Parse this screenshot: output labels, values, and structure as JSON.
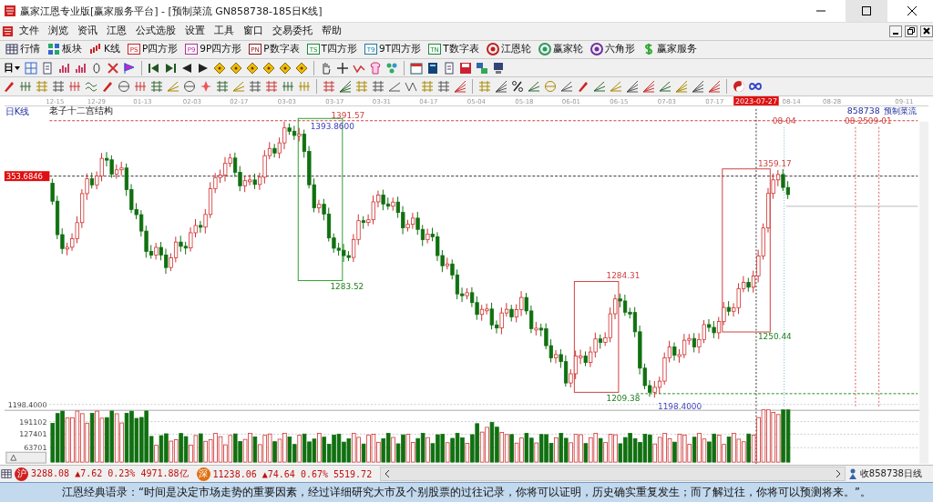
{
  "window": {
    "title": "赢家江恩专业版[赢家服务平台] - [预制菜流  GN858738-185日K线]"
  },
  "menu": [
    "文件",
    "浏览",
    "资讯",
    "江恩",
    "公式选股",
    "设置",
    "工具",
    "窗口",
    "交易委托",
    "帮助"
  ],
  "toolbar": [
    {
      "label": "行情",
      "kind": "table"
    },
    {
      "label": "板块",
      "kind": "blocks"
    },
    {
      "label": "K线",
      "kind": "kline"
    },
    {
      "label": "P四方形",
      "kind": "tag",
      "tag": "PS",
      "color": "#cc2222"
    },
    {
      "label": "9P四方形",
      "kind": "tag",
      "tag": "P9",
      "color": "#b0309a"
    },
    {
      "label": "P数字表",
      "kind": "tag",
      "tag": "PN",
      "color": "#8a1a1a"
    },
    {
      "label": "T四方形",
      "kind": "tag",
      "tag": "TS",
      "color": "#1a8a3a"
    },
    {
      "label": "9T四方形",
      "kind": "tag",
      "tag": "T9",
      "color": "#1a7aa0"
    },
    {
      "label": "T数字表",
      "kind": "tag",
      "tag": "TN",
      "color": "#1a8a3a"
    },
    {
      "label": "江恩轮",
      "kind": "wheel",
      "color": "#c02020"
    },
    {
      "label": "赢家轮",
      "kind": "wheel",
      "color": "#2a9a5a"
    },
    {
      "label": "六角形",
      "kind": "wheel",
      "color": "#7030a0"
    },
    {
      "label": "赢家服务",
      "kind": "dollar"
    }
  ],
  "period_selector": "日",
  "chart": {
    "period_label": "日K线",
    "study_title": "老子十二宫结构",
    "price_tag": "353.6846",
    "code": "858738",
    "name": "预制菜流",
    "dates": [
      {
        "label": "12-15",
        "selected": false
      },
      {
        "label": "12-29",
        "selected": false
      },
      {
        "label": "01-13",
        "selected": false
      },
      {
        "label": "02-03",
        "selected": false
      },
      {
        "label": "02-17",
        "selected": false
      },
      {
        "label": "03-03",
        "selected": false
      },
      {
        "label": "03-17",
        "selected": false
      },
      {
        "label": "03-31",
        "selected": false
      },
      {
        "label": "04-17",
        "selected": false
      },
      {
        "label": "05-04",
        "selected": false
      },
      {
        "label": "05-18",
        "selected": false
      },
      {
        "label": "06-01",
        "selected": false
      },
      {
        "label": "06-15",
        "selected": false
      },
      {
        "label": "07-03",
        "selected": false
      },
      {
        "label": "07-17",
        "selected": false
      },
      {
        "label": "2023-07-27",
        "selected": true
      },
      {
        "label": "08-14",
        "selected": false
      },
      {
        "label": "08-28",
        "selected": false
      },
      {
        "label": "09-11",
        "selected": false
      }
    ],
    "annotations": [
      {
        "text": "1391.57",
        "color": "#d04040"
      },
      {
        "text": "1393.8600",
        "color": "#4040c0"
      },
      {
        "text": "1283.52",
        "color": "#208020"
      },
      {
        "text": "1284.31",
        "color": "#d04040"
      },
      {
        "text": "1209.38",
        "color": "#208020"
      },
      {
        "text": "1198.4000",
        "color": "#4040c0"
      },
      {
        "text": "1359.17",
        "color": "#d04040"
      },
      {
        "text": "1250.44",
        "color": "#208020"
      },
      {
        "text": "08-04",
        "color": "#d04040"
      },
      {
        "text": "08-25",
        "color": "#d04040"
      },
      {
        "text": "09-01",
        "color": "#d04040"
      }
    ]
  },
  "volume": {
    "axis_labels": [
      "1198.4000",
      "191102",
      "127401",
      "63701"
    ]
  },
  "status_bar": {
    "indices": [
      {
        "badge": "沪",
        "text": "3288.08 ▲7.62 0.23% 4971.88亿",
        "color": "#d02020"
      },
      {
        "badge": "深",
        "text": "11238.06 ▲74.64 0.67% 5519.72",
        "color": "#e07010"
      }
    ],
    "right_label": "收858738日线"
  },
  "quote": "江恩经典语录：“时间是决定市场走势的重要因素，经过详细研究大市及个别股票的过往记录，你将可以证明，历史确实重复发生；而了解过往，你将可以预测将来。”。"
}
